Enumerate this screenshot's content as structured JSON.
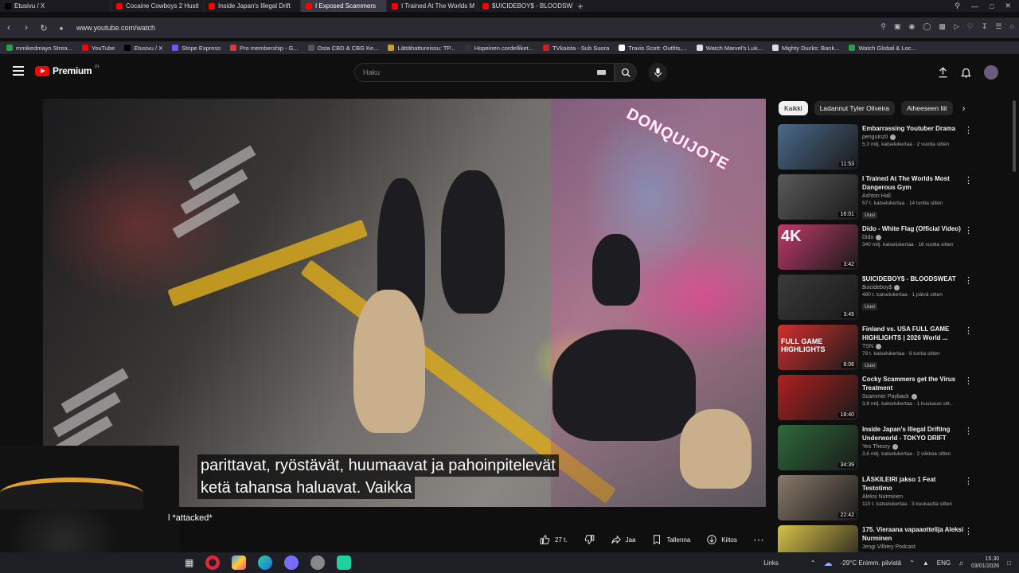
{
  "browser": {
    "tabs": [
      {
        "label": "Etusivu / X",
        "active": false,
        "color": "#000000"
      },
      {
        "label": "Cocaine Cowboys 2 Hustl",
        "active": false,
        "color": "#ff0000"
      },
      {
        "label": "Inside Japan's Illegal Drift",
        "active": false,
        "color": "#ff0000"
      },
      {
        "label": "I Exposed Scammers",
        "active": true,
        "color": "#ff0000"
      },
      {
        "label": "I Trained At The Worlds M",
        "active": false,
        "color": "#ff0000"
      },
      {
        "label": "$UICIDEBOY$ - BLOODSW",
        "active": false,
        "color": "#ff0000"
      }
    ],
    "url": "www.youtube.com/watch",
    "bookmarks": [
      {
        "label": "mmikedmayn Strea...",
        "color": "#2a9d4a"
      },
      {
        "label": "YouTube",
        "color": "#ff0000"
      },
      {
        "label": "Etusivu / X",
        "color": "#000000"
      },
      {
        "label": "Stripe Express",
        "color": "#635bff"
      },
      {
        "label": "Pro membership - G...",
        "color": "#d23c3c"
      },
      {
        "label": "Osta CBD & CBG Ke...",
        "color": "#555555"
      },
      {
        "label": "Lättähattureissu: TP...",
        "color": "#c9a227"
      },
      {
        "label": "Hopeinen cordelliket...",
        "color": "#333333"
      },
      {
        "label": "TVkaista - Sub Suora",
        "color": "#cc2222"
      },
      {
        "label": "Travis Scott: Outfits,...",
        "color": "#ffffff"
      },
      {
        "label": "Watch Marvel's Luk...",
        "color": "#dddddd"
      },
      {
        "label": "Mighty Ducks: Bank...",
        "color": "#dddddd"
      },
      {
        "label": "Watch Global & Loc...",
        "color": "#2a9d4a"
      }
    ]
  },
  "youtube": {
    "logo": "Premium",
    "logo_sup": "FI",
    "search_placeholder": "Haku"
  },
  "video": {
    "store_sign": "DONQUIJOTE",
    "captions": [
      "parittavat, ryöstävät, huumaavat ja pahoinpitelevät",
      "ketä tahansa haluavat.  Vaikka"
    ],
    "overlay_text": "l *attacked*"
  },
  "actions": {
    "like_count": "27 t.",
    "share": "Jaa",
    "save": "Tallenna",
    "thanks": "Kiitos"
  },
  "chips": [
    "Kaikki",
    "Ladannut Tyler Oliveira",
    "Aiheeseen liit"
  ],
  "recommendations": [
    {
      "title": "Embarrassing Youtuber Drama",
      "channel": "penguinz0",
      "meta": "5,3 milj. katselukertaa · 2 vuotta sitten",
      "duration": "11:53",
      "badge": "",
      "thumb_color": "#4a6a8a",
      "thumb_text": "",
      "verified": true
    },
    {
      "title": "I Trained At The Worlds Most Dangerous Gym",
      "channel": "Ashton Hall",
      "meta": "57 t. katselukertaa · 14 tuntia sitten",
      "duration": "16:01",
      "badge": "Uusi",
      "thumb_color": "#5a5a5a",
      "thumb_text": "",
      "verified": false
    },
    {
      "title": "Dido - White Flag (Official Video)",
      "channel": "Dido",
      "meta": "340 milj. katselukertaa · 16 vuotta sitten",
      "duration": "3:42",
      "badge": "",
      "thumb_color": "#c03a6a",
      "thumb_text": "4K",
      "verified": true
    },
    {
      "title": "$UICIDEBOY$ - BLOODSWEAT",
      "channel": "$uicideboy$",
      "meta": "480 t. katselukertaa · 1 päivä sitten",
      "duration": "3:45",
      "badge": "Uusi",
      "thumb_color": "#3a3a3a",
      "thumb_text": "",
      "verified": true
    },
    {
      "title": "Finland vs. USA FULL GAME HIGHLIGHTS | 2026 World ...",
      "channel": "TSN",
      "meta": "79 t. katselukertaa · 8 tuntia sitten",
      "duration": "8:06",
      "badge": "Uusi",
      "thumb_color": "#d32f2f",
      "thumb_text": "FULL GAME HIGHLIGHTS",
      "verified": true
    },
    {
      "title": "Cocky Scammers get the Virus Treatment",
      "channel": "Scammer Payback",
      "meta": "3,8 milj. katselukertaa · 1 kuukausi sitt...",
      "duration": "18:40",
      "badge": "",
      "thumb_color": "#b02020",
      "thumb_text": "",
      "verified": true
    },
    {
      "title": "Inside Japan's Illegal Drifting Underworld - TOKYO DRIFT",
      "channel": "Yes Theory",
      "meta": "3,6 milj. katselukertaa · 2 viikkoa sitten",
      "duration": "34:39",
      "badge": "",
      "thumb_color": "#2e6a3a",
      "thumb_text": "",
      "verified": true
    },
    {
      "title": "LÄSKILEIRI jakso 1 Feat Testotimo",
      "channel": "Aleksi Nurminen",
      "meta": "110 t. katselukertaa · 3 kuukautta sitten",
      "duration": "22:42",
      "badge": "",
      "thumb_color": "#8a7a6a",
      "thumb_text": "",
      "verified": false
    },
    {
      "title": "175. Vieraana vapaaottelija Aleksi Nurminen",
      "channel": "Jengi Vilbtey Podcast",
      "meta": "",
      "duration": "",
      "badge": "",
      "thumb_color": "#d8c24a",
      "thumb_text": "",
      "verified": false
    }
  ],
  "taskbar": {
    "links": "Links",
    "weather": "-29°C  Enimm. pilvistä",
    "lang": "ENG",
    "time": "15.30",
    "date": "03/01/2026"
  }
}
